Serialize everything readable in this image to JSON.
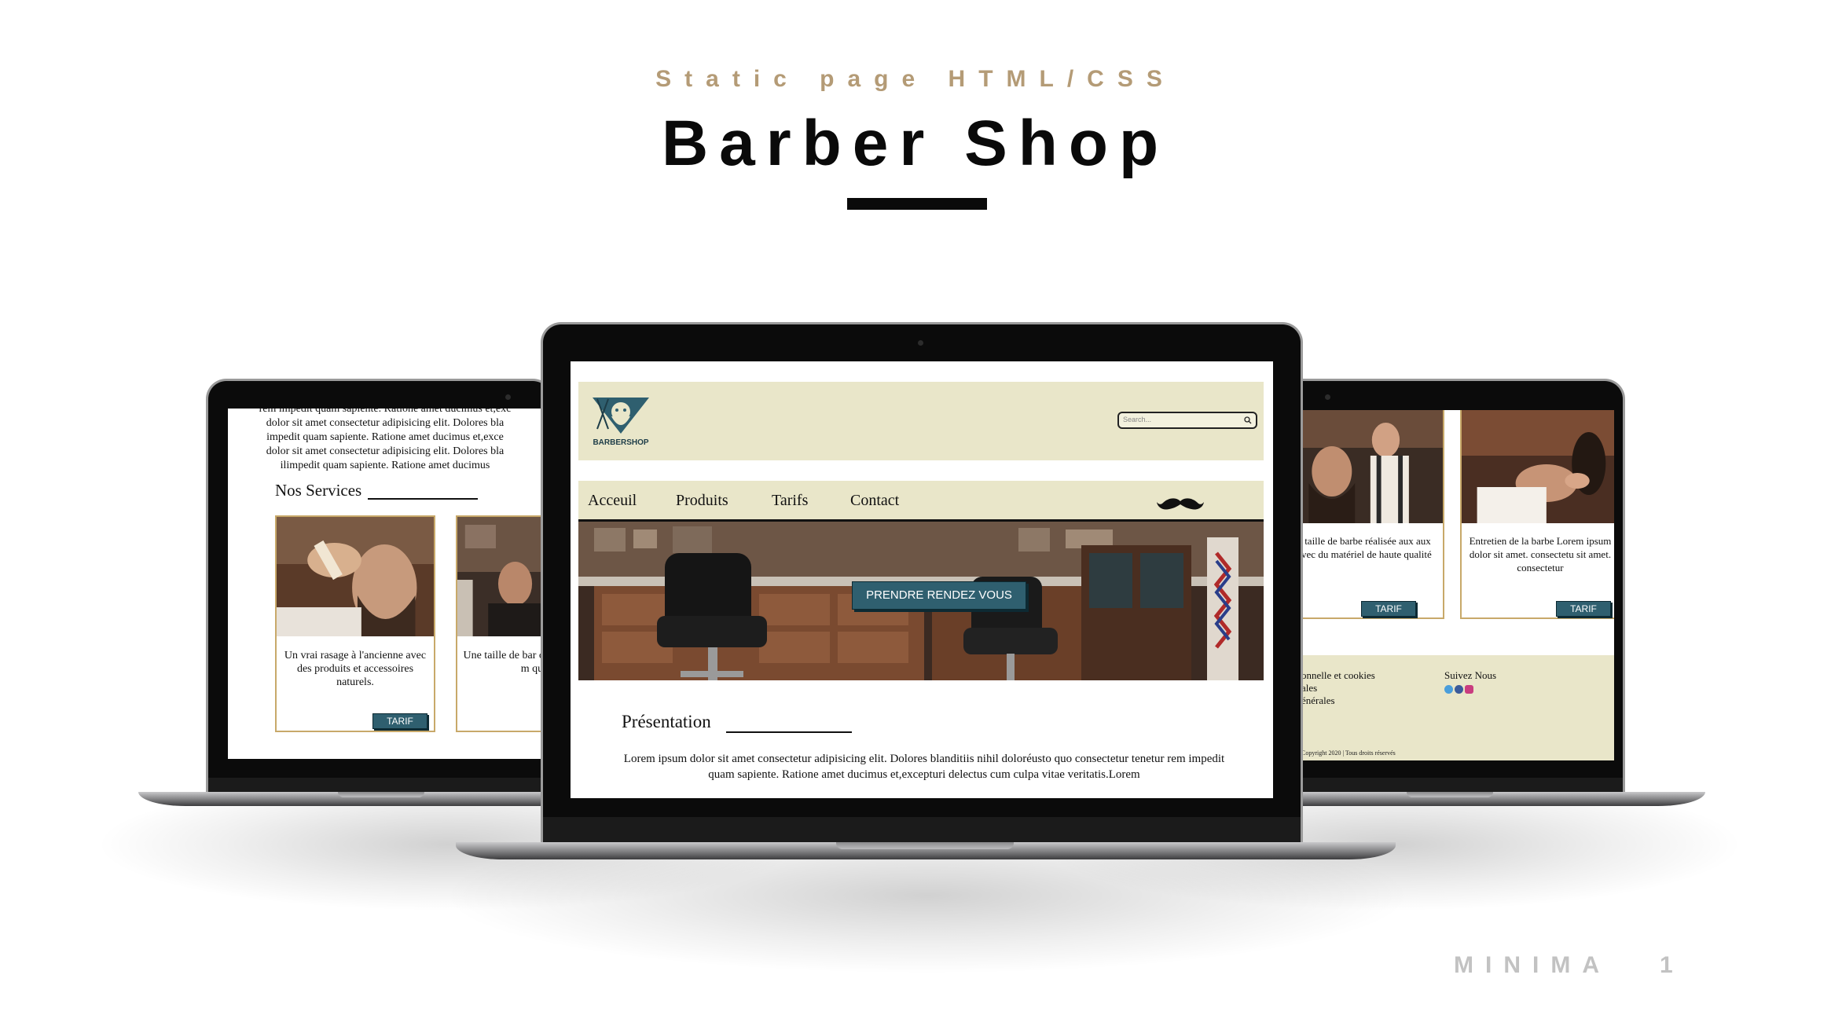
{
  "slide": {
    "subtitle": "Static page HTML/CSS",
    "title": "Barber Shop",
    "brand": "MINIMA",
    "page_number": "1"
  },
  "colors": {
    "accent_gold": "#b49b76",
    "site_beige": "#e9e6c9",
    "button_teal": "#2f5f6f",
    "card_border": "#c8a96a"
  },
  "left_screen": {
    "paragraph_lines": [
      "rem impedit quam sapiente. Ratione amet ducimus et,exc",
      "dolor sit amet consectetur adipisicing elit. Dolores bla",
      "impedit quam sapiente. Ratione amet ducimus et,exce",
      "dolor sit amet consectetur adipisicing elit. Dolores bla",
      "ilimpedit quam sapiente. Ratione amet ducimus"
    ],
    "services_heading": "Nos Services",
    "cards": [
      {
        "text": "Un vrai rasage à l'ancienne avec des produits et accessoires naturels.",
        "button": "TARIF"
      },
      {
        "text": "Une taille de bar ciseaux avec du m qual",
        "button": "TARIF"
      }
    ]
  },
  "center_screen": {
    "logo_text": "BARBERSHOP",
    "search_placeholder": "Search...",
    "nav": [
      "Acceuil",
      "Produits",
      "Tarifs",
      "Contact"
    ],
    "cta_label": "PRENDRE RENDEZ VOUS",
    "presentation_title": "Présentation",
    "presentation_text": "Lorem ipsum dolor sit amet consectetur adipisicing elit. Dolores blanditiis nihil doloréusto quo consectetur tenetur rem impedit quam sapiente. Ratione amet ducimus et,excepturi delectus cum culpa vitae veritatis.Lorem"
  },
  "right_screen": {
    "cards": [
      {
        "text": "e taille de barbe réalisée aux aux avec du matériel de haute qualité",
        "button": "TARIF"
      },
      {
        "text": "Entretien de la barbe Lorem ipsum dolor sit amet. consectetu sit amet. consectetur",
        "button": "TARIF"
      }
    ],
    "footer": {
      "links": [
        "onnelle et cookies",
        "ales",
        "énérales"
      ],
      "follow_label": "Suivez Nous",
      "social_icons": [
        "twitter-icon",
        "facebook-icon",
        "instagram-icon"
      ],
      "copyright": "Copyright 2020 | Tous droits réservés"
    }
  }
}
